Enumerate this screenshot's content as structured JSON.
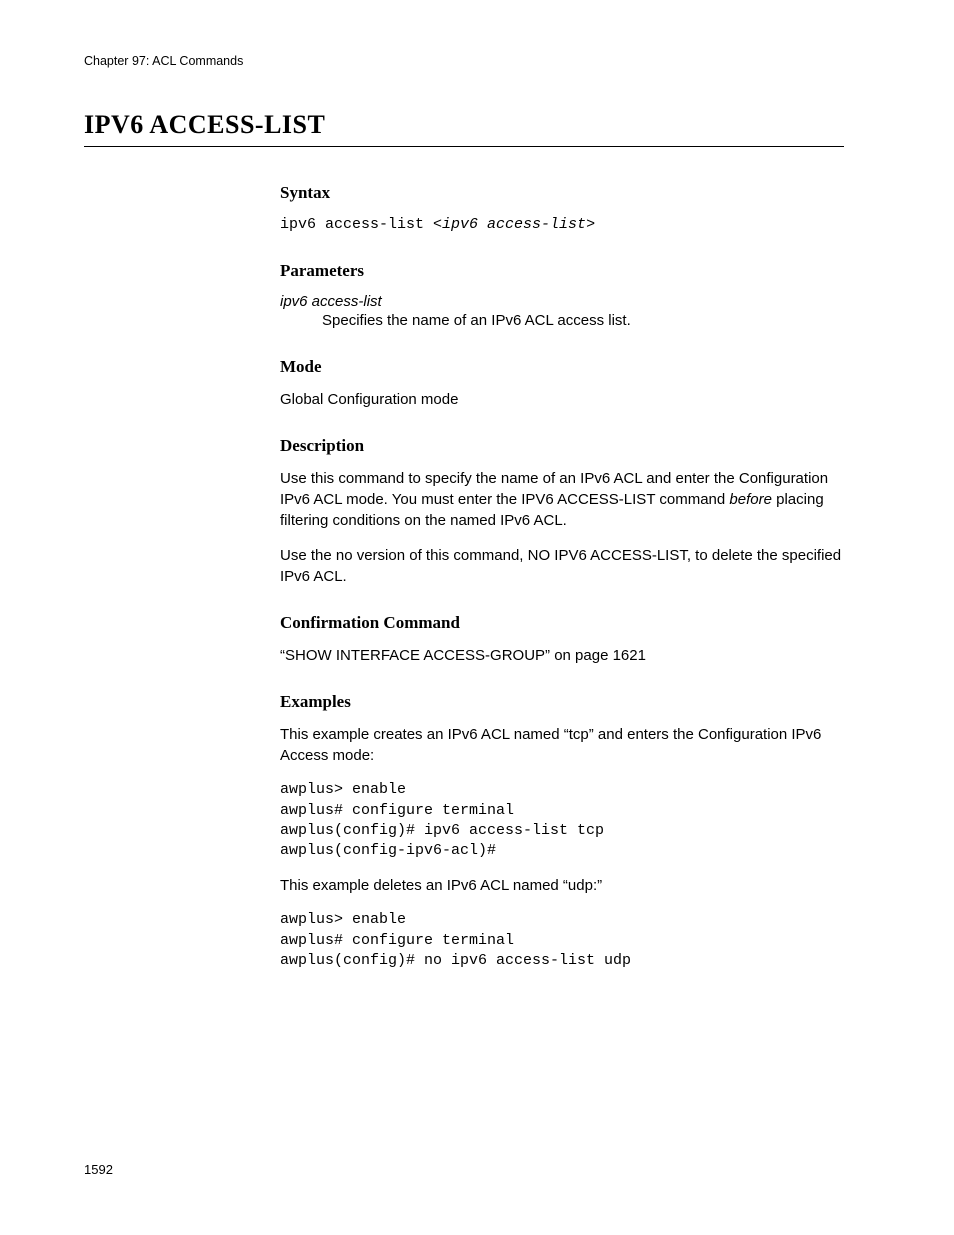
{
  "chapter": "Chapter 97: ACL Commands",
  "title": "IPV6 ACCESS-LIST",
  "headings": {
    "syntax": "Syntax",
    "parameters": "Parameters",
    "mode": "Mode",
    "description": "Description",
    "confirmation": "Confirmation Command",
    "examples": "Examples"
  },
  "syntax": {
    "cmd_prefix": "ipv6 access-list <",
    "cmd_arg": "ipv6 access-list",
    "cmd_suffix": ">"
  },
  "parameters": {
    "name": "ipv6 access-list",
    "desc": "Specifies the name of an IPv6 ACL access list."
  },
  "mode_text": "Global Configuration mode",
  "description": {
    "p1_a": "Use this command to specify the name of an IPv6 ACL and enter the Configuration IPv6 ACL mode. You must enter the IPV6 ACCESS-LIST command ",
    "p1_em": "before",
    "p1_b": " placing filtering conditions on the named IPv6 ACL.",
    "p2": "Use the no version of this command, NO IPV6 ACCESS-LIST, to delete the specified IPv6 ACL."
  },
  "confirmation_text": "“SHOW INTERFACE ACCESS-GROUP” on page 1621",
  "examples": {
    "intro1": "This example creates an IPv6 ACL named “tcp” and enters the Configuration IPv6 Access mode:",
    "code1": "awplus> enable\nawplus# configure terminal\nawplus(config)# ipv6 access-list tcp\nawplus(config-ipv6-acl)#",
    "intro2": "This example deletes an IPv6 ACL named “udp:”",
    "code2": "awplus> enable\nawplus# configure terminal\nawplus(config)# no ipv6 access-list udp"
  },
  "page_number": "1592"
}
